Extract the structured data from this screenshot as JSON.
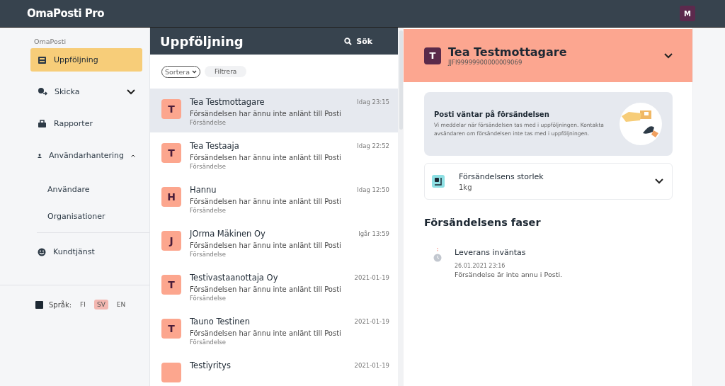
{
  "app": {
    "title": "OmaPosti Pro",
    "user_initial": "M"
  },
  "sidebar": {
    "section_label": "OmaPosti",
    "items": [
      {
        "label": "Uppföljning",
        "selected": true
      },
      {
        "label": "Skicka",
        "selected": false,
        "expanded": false
      },
      {
        "label": "Rapporter",
        "selected": false
      },
      {
        "label": "Användarhantering",
        "selected": false,
        "expanded": true,
        "children": [
          {
            "label": "Användare",
            "selected": false
          },
          {
            "label": "Organisationer",
            "selected": false
          }
        ]
      },
      {
        "label": "Kundtjänst",
        "selected": false
      }
    ],
    "language": {
      "label": "Språk:",
      "options": [
        {
          "label": "FI",
          "selected": false
        },
        {
          "label": "SV",
          "selected": true
        },
        {
          "label": "EN",
          "selected": false
        }
      ]
    }
  },
  "list": {
    "title": "Uppföljning",
    "search": "Sök",
    "sort": "Sortera",
    "filter": "Filtrera",
    "rows": [
      {
        "initial": "T",
        "name": "Tea Testmottagare",
        "status": "Försändelsen har ännu inte anlänt till Posti",
        "type": "Försändelse",
        "time": "Idag 23:15",
        "selected": true
      },
      {
        "initial": "T",
        "name": "Tea Testaaja",
        "status": "Försändelsen har ännu inte anlänt till Posti",
        "type": "Försändelse",
        "time": "Idag 22:52",
        "selected": false
      },
      {
        "initial": "H",
        "name": "Hannu",
        "status": "Försändelsen har ännu inte anlänt till Posti",
        "type": "Försändelse",
        "time": "Idag 12:50",
        "selected": false
      },
      {
        "initial": "J",
        "name": "JOrma Mäkinen Oy",
        "status": "Försändelsen har ännu inte anlänt till Posti",
        "type": "Försändelse",
        "time": "Igår 13:59",
        "selected": false
      },
      {
        "initial": "T",
        "name": "Testivastaanottaja Oy",
        "status": "Försändelsen har ännu inte anlänt till Posti",
        "type": "Försändelse",
        "time": "2021-01-19",
        "selected": false
      },
      {
        "initial": "T",
        "name": "Tauno Testinen",
        "status": "Försändelsen har ännu inte anlänt till Posti",
        "type": "Försändelse",
        "time": "2021-01-19",
        "selected": false
      },
      {
        "name": "Testiyritys",
        "time": "2021-01-19",
        "selected": false
      }
    ]
  },
  "detail": {
    "initial": "T",
    "name": "Tea Testmottagare",
    "tracking": "JJFI99999900000009069",
    "expanded": false,
    "notice": {
      "title": "Posti väntar på försändelsen",
      "text": "Vi meddelar när försändelsen tas med i uppföljningen. Kontakta avsändaren om försändelsen inte tas med i uppföljningen."
    },
    "size": {
      "title": "Försändelsens storlek",
      "value": "1kg"
    },
    "phases": {
      "title": "Försändelsens faser",
      "items": [
        {
          "title": "Leverans inväntas",
          "date": "26.01.2021 23:16",
          "text": "Försändelse är inte annu i Posti."
        }
      ]
    }
  }
}
